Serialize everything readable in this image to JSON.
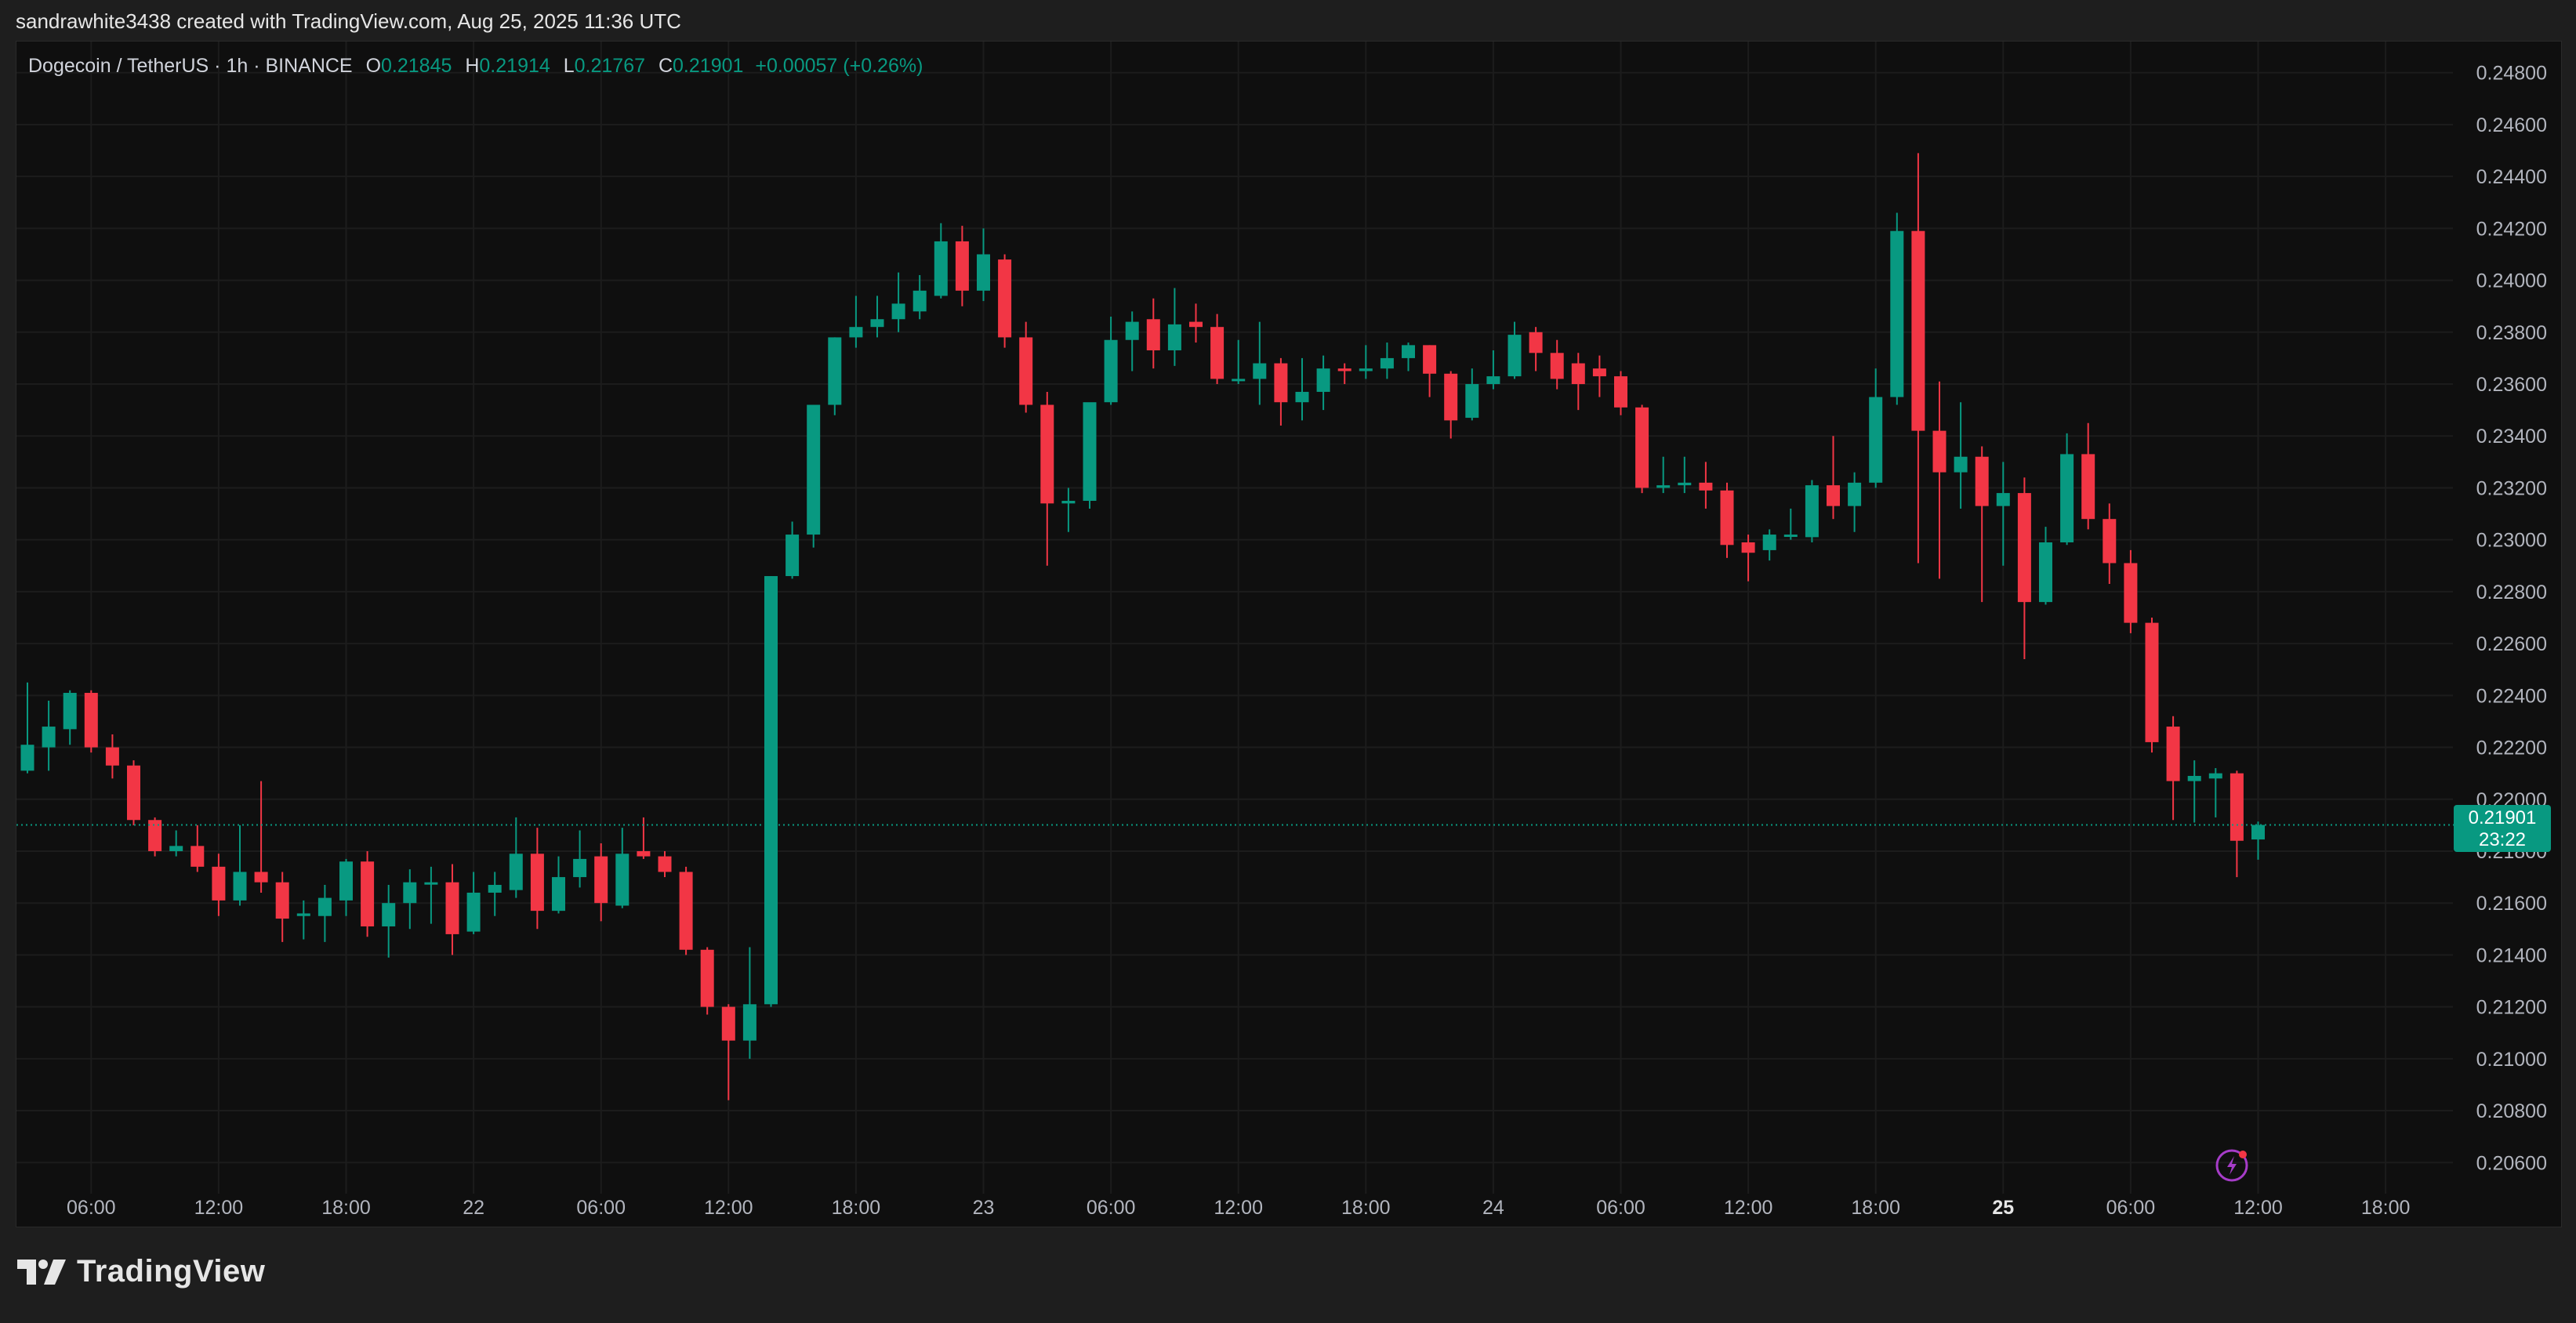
{
  "header": {
    "text": "sandrawhite3438 created with TradingView.com, Aug 25, 2025 11:36 UTC"
  },
  "legend": {
    "symbol": "Dogecoin / TetherUS · 1h · BINANCE",
    "o_label": "O",
    "o": "0.21845",
    "h_label": "H",
    "h": "0.21914",
    "l_label": "L",
    "l": "0.21767",
    "c_label": "C",
    "c": "0.21901",
    "change": "+0.00057 (+0.26%)"
  },
  "last_price": {
    "price": "0.21901",
    "countdown": "23:22"
  },
  "brand": {
    "name": "TradingView"
  },
  "colors": {
    "up": "#089981",
    "down": "#f23645",
    "background": "#0f0f0f",
    "grid": "#1c1c1c"
  },
  "chart_data": {
    "type": "candlestick",
    "title": "",
    "ylim": [
      0.2048,
      0.2492
    ],
    "y_ticks": [
      "0.20600",
      "0.20800",
      "0.21000",
      "0.21200",
      "0.21400",
      "0.21600",
      "0.21800",
      "0.22000",
      "0.22200",
      "0.22400",
      "0.22600",
      "0.22800",
      "0.23000",
      "0.23200",
      "0.23400",
      "0.23600",
      "0.23800",
      "0.24000",
      "0.24200",
      "0.24400",
      "0.24600",
      "0.24800"
    ],
    "x_ticks": [
      {
        "label": "06:00",
        "index": 3,
        "bold": false
      },
      {
        "label": "12:00",
        "index": 9,
        "bold": false
      },
      {
        "label": "18:00",
        "index": 15,
        "bold": false
      },
      {
        "label": "22",
        "index": 21,
        "bold": false
      },
      {
        "label": "06:00",
        "index": 27,
        "bold": false
      },
      {
        "label": "12:00",
        "index": 33,
        "bold": false
      },
      {
        "label": "18:00",
        "index": 39,
        "bold": false
      },
      {
        "label": "23",
        "index": 45,
        "bold": false
      },
      {
        "label": "06:00",
        "index": 51,
        "bold": false
      },
      {
        "label": "12:00",
        "index": 57,
        "bold": false
      },
      {
        "label": "18:00",
        "index": 63,
        "bold": false
      },
      {
        "label": "24",
        "index": 69,
        "bold": false
      },
      {
        "label": "06:00",
        "index": 75,
        "bold": false
      },
      {
        "label": "12:00",
        "index": 81,
        "bold": false
      },
      {
        "label": "18:00",
        "index": 87,
        "bold": false
      },
      {
        "label": "25",
        "index": 93,
        "bold": true
      },
      {
        "label": "06:00",
        "index": 99,
        "bold": false
      },
      {
        "label": "12:00",
        "index": 105,
        "bold": false
      },
      {
        "label": "18:00",
        "index": 111,
        "bold": false
      }
    ],
    "current_price": 0.21901,
    "candles": [
      {
        "o": 0.2211,
        "h": 0.2245,
        "l": 0.221,
        "c": 0.2221
      },
      {
        "o": 0.222,
        "h": 0.2238,
        "l": 0.2211,
        "c": 0.2228
      },
      {
        "o": 0.2227,
        "h": 0.2242,
        "l": 0.2221,
        "c": 0.2241
      },
      {
        "o": 0.2241,
        "h": 0.2242,
        "l": 0.2218,
        "c": 0.222
      },
      {
        "o": 0.222,
        "h": 0.2225,
        "l": 0.2208,
        "c": 0.2213
      },
      {
        "o": 0.2213,
        "h": 0.2215,
        "l": 0.219,
        "c": 0.2192
      },
      {
        "o": 0.2192,
        "h": 0.2193,
        "l": 0.2178,
        "c": 0.218
      },
      {
        "o": 0.218,
        "h": 0.2188,
        "l": 0.2178,
        "c": 0.2182
      },
      {
        "o": 0.2182,
        "h": 0.219,
        "l": 0.2172,
        "c": 0.2174
      },
      {
        "o": 0.2174,
        "h": 0.2179,
        "l": 0.2155,
        "c": 0.2161
      },
      {
        "o": 0.2161,
        "h": 0.219,
        "l": 0.2159,
        "c": 0.2172
      },
      {
        "o": 0.2172,
        "h": 0.2207,
        "l": 0.2164,
        "c": 0.2168
      },
      {
        "o": 0.2168,
        "h": 0.2172,
        "l": 0.2145,
        "c": 0.2154
      },
      {
        "o": 0.2155,
        "h": 0.2161,
        "l": 0.2146,
        "c": 0.2156
      },
      {
        "o": 0.2155,
        "h": 0.2167,
        "l": 0.2145,
        "c": 0.2162
      },
      {
        "o": 0.2161,
        "h": 0.2177,
        "l": 0.2155,
        "c": 0.2176
      },
      {
        "o": 0.2176,
        "h": 0.218,
        "l": 0.2147,
        "c": 0.2151
      },
      {
        "o": 0.2151,
        "h": 0.2167,
        "l": 0.2139,
        "c": 0.216
      },
      {
        "o": 0.216,
        "h": 0.2173,
        "l": 0.215,
        "c": 0.2168
      },
      {
        "o": 0.2168,
        "h": 0.2174,
        "l": 0.2152,
        "c": 0.2168
      },
      {
        "o": 0.2168,
        "h": 0.2175,
        "l": 0.214,
        "c": 0.2148
      },
      {
        "o": 0.2149,
        "h": 0.2172,
        "l": 0.2148,
        "c": 0.2164
      },
      {
        "o": 0.2164,
        "h": 0.2172,
        "l": 0.2155,
        "c": 0.2167
      },
      {
        "o": 0.2165,
        "h": 0.2193,
        "l": 0.2162,
        "c": 0.2179
      },
      {
        "o": 0.2179,
        "h": 0.2189,
        "l": 0.215,
        "c": 0.2157
      },
      {
        "o": 0.2157,
        "h": 0.2178,
        "l": 0.2156,
        "c": 0.217
      },
      {
        "o": 0.217,
        "h": 0.2188,
        "l": 0.2166,
        "c": 0.2177
      },
      {
        "o": 0.2178,
        "h": 0.2183,
        "l": 0.2153,
        "c": 0.216
      },
      {
        "o": 0.2159,
        "h": 0.2189,
        "l": 0.2158,
        "c": 0.2179
      },
      {
        "o": 0.218,
        "h": 0.2193,
        "l": 0.2177,
        "c": 0.2178
      },
      {
        "o": 0.2178,
        "h": 0.218,
        "l": 0.217,
        "c": 0.2172
      },
      {
        "o": 0.2172,
        "h": 0.2174,
        "l": 0.214,
        "c": 0.2142
      },
      {
        "o": 0.2142,
        "h": 0.2143,
        "l": 0.2117,
        "c": 0.212
      },
      {
        "o": 0.212,
        "h": 0.2121,
        "l": 0.2084,
        "c": 0.2107
      },
      {
        "o": 0.2107,
        "h": 0.2143,
        "l": 0.21,
        "c": 0.2121
      },
      {
        "o": 0.2121,
        "h": 0.2286,
        "l": 0.212,
        "c": 0.2286
      },
      {
        "o": 0.2286,
        "h": 0.2307,
        "l": 0.2285,
        "c": 0.2302
      },
      {
        "o": 0.2302,
        "h": 0.2352,
        "l": 0.2297,
        "c": 0.2352
      },
      {
        "o": 0.2352,
        "h": 0.2378,
        "l": 0.2348,
        "c": 0.2378
      },
      {
        "o": 0.2378,
        "h": 0.2394,
        "l": 0.2374,
        "c": 0.2382
      },
      {
        "o": 0.2382,
        "h": 0.2394,
        "l": 0.2378,
        "c": 0.2385
      },
      {
        "o": 0.2385,
        "h": 0.2403,
        "l": 0.238,
        "c": 0.2391
      },
      {
        "o": 0.2388,
        "h": 0.2402,
        "l": 0.2385,
        "c": 0.2396
      },
      {
        "o": 0.2394,
        "h": 0.2422,
        "l": 0.2393,
        "c": 0.2415
      },
      {
        "o": 0.2415,
        "h": 0.2421,
        "l": 0.239,
        "c": 0.2396
      },
      {
        "o": 0.2396,
        "h": 0.242,
        "l": 0.2392,
        "c": 0.241
      },
      {
        "o": 0.2408,
        "h": 0.241,
        "l": 0.2374,
        "c": 0.2378
      },
      {
        "o": 0.2378,
        "h": 0.2384,
        "l": 0.2349,
        "c": 0.2352
      },
      {
        "o": 0.2352,
        "h": 0.2357,
        "l": 0.229,
        "c": 0.2314
      },
      {
        "o": 0.2314,
        "h": 0.232,
        "l": 0.2303,
        "c": 0.2315
      },
      {
        "o": 0.2315,
        "h": 0.2352,
        "l": 0.2312,
        "c": 0.2353
      },
      {
        "o": 0.2353,
        "h": 0.2386,
        "l": 0.2352,
        "c": 0.2377
      },
      {
        "o": 0.2377,
        "h": 0.2388,
        "l": 0.2365,
        "c": 0.2384
      },
      {
        "o": 0.2385,
        "h": 0.2393,
        "l": 0.2366,
        "c": 0.2373
      },
      {
        "o": 0.2373,
        "h": 0.2397,
        "l": 0.2367,
        "c": 0.2383
      },
      {
        "o": 0.2384,
        "h": 0.2391,
        "l": 0.2376,
        "c": 0.2382
      },
      {
        "o": 0.2382,
        "h": 0.2387,
        "l": 0.236,
        "c": 0.2362
      },
      {
        "o": 0.2362,
        "h": 0.2377,
        "l": 0.236,
        "c": 0.2362
      },
      {
        "o": 0.2362,
        "h": 0.2384,
        "l": 0.2352,
        "c": 0.2368
      },
      {
        "o": 0.2368,
        "h": 0.237,
        "l": 0.2344,
        "c": 0.2353
      },
      {
        "o": 0.2353,
        "h": 0.237,
        "l": 0.2346,
        "c": 0.2357
      },
      {
        "o": 0.2357,
        "h": 0.2371,
        "l": 0.235,
        "c": 0.2366
      },
      {
        "o": 0.2366,
        "h": 0.2368,
        "l": 0.236,
        "c": 0.2365
      },
      {
        "o": 0.2365,
        "h": 0.2375,
        "l": 0.2362,
        "c": 0.2366
      },
      {
        "o": 0.2366,
        "h": 0.2376,
        "l": 0.2362,
        "c": 0.237
      },
      {
        "o": 0.237,
        "h": 0.2376,
        "l": 0.2365,
        "c": 0.2375
      },
      {
        "o": 0.2375,
        "h": 0.2375,
        "l": 0.2355,
        "c": 0.2364
      },
      {
        "o": 0.2364,
        "h": 0.2365,
        "l": 0.2339,
        "c": 0.2346
      },
      {
        "o": 0.2347,
        "h": 0.2366,
        "l": 0.2346,
        "c": 0.236
      },
      {
        "o": 0.236,
        "h": 0.2373,
        "l": 0.2358,
        "c": 0.2363
      },
      {
        "o": 0.2363,
        "h": 0.2384,
        "l": 0.2362,
        "c": 0.2379
      },
      {
        "o": 0.238,
        "h": 0.2382,
        "l": 0.2365,
        "c": 0.2372
      },
      {
        "o": 0.2372,
        "h": 0.2377,
        "l": 0.2358,
        "c": 0.2362
      },
      {
        "o": 0.2368,
        "h": 0.2372,
        "l": 0.235,
        "c": 0.236
      },
      {
        "o": 0.2366,
        "h": 0.2371,
        "l": 0.2355,
        "c": 0.2363
      },
      {
        "o": 0.2363,
        "h": 0.2365,
        "l": 0.2348,
        "c": 0.2351
      },
      {
        "o": 0.2351,
        "h": 0.2352,
        "l": 0.2318,
        "c": 0.232
      },
      {
        "o": 0.232,
        "h": 0.2332,
        "l": 0.2318,
        "c": 0.2321
      },
      {
        "o": 0.2321,
        "h": 0.2332,
        "l": 0.2318,
        "c": 0.2322
      },
      {
        "o": 0.2322,
        "h": 0.233,
        "l": 0.2312,
        "c": 0.2319
      },
      {
        "o": 0.2319,
        "h": 0.2322,
        "l": 0.2293,
        "c": 0.2298
      },
      {
        "o": 0.2299,
        "h": 0.2302,
        "l": 0.2284,
        "c": 0.2295
      },
      {
        "o": 0.2296,
        "h": 0.2304,
        "l": 0.2292,
        "c": 0.2302
      },
      {
        "o": 0.2302,
        "h": 0.2312,
        "l": 0.23,
        "c": 0.2302
      },
      {
        "o": 0.2301,
        "h": 0.2323,
        "l": 0.2299,
        "c": 0.2321
      },
      {
        "o": 0.2321,
        "h": 0.234,
        "l": 0.2308,
        "c": 0.2313
      },
      {
        "o": 0.2313,
        "h": 0.2326,
        "l": 0.2303,
        "c": 0.2322
      },
      {
        "o": 0.2322,
        "h": 0.2366,
        "l": 0.232,
        "c": 0.2355
      },
      {
        "o": 0.2355,
        "h": 0.2426,
        "l": 0.2352,
        "c": 0.2419
      },
      {
        "o": 0.2419,
        "h": 0.2449,
        "l": 0.2291,
        "c": 0.2342
      },
      {
        "o": 0.2342,
        "h": 0.2361,
        "l": 0.2285,
        "c": 0.2326
      },
      {
        "o": 0.2326,
        "h": 0.2353,
        "l": 0.2312,
        "c": 0.2332
      },
      {
        "o": 0.2332,
        "h": 0.2336,
        "l": 0.2276,
        "c": 0.2313
      },
      {
        "o": 0.2313,
        "h": 0.233,
        "l": 0.229,
        "c": 0.2318
      },
      {
        "o": 0.2318,
        "h": 0.2324,
        "l": 0.2254,
        "c": 0.2276
      },
      {
        "o": 0.2276,
        "h": 0.2305,
        "l": 0.2275,
        "c": 0.2299
      },
      {
        "o": 0.2299,
        "h": 0.2341,
        "l": 0.2298,
        "c": 0.2333
      },
      {
        "o": 0.2333,
        "h": 0.2345,
        "l": 0.2304,
        "c": 0.2308
      },
      {
        "o": 0.2308,
        "h": 0.2314,
        "l": 0.2283,
        "c": 0.2291
      },
      {
        "o": 0.2291,
        "h": 0.2296,
        "l": 0.2264,
        "c": 0.2268
      },
      {
        "o": 0.2268,
        "h": 0.227,
        "l": 0.2218,
        "c": 0.2222
      },
      {
        "o": 0.2228,
        "h": 0.2232,
        "l": 0.2192,
        "c": 0.2207
      },
      {
        "o": 0.2207,
        "h": 0.2215,
        "l": 0.2191,
        "c": 0.2209
      },
      {
        "o": 0.2208,
        "h": 0.2212,
        "l": 0.2193,
        "c": 0.221
      },
      {
        "o": 0.221,
        "h": 0.2211,
        "l": 0.217,
        "c": 0.2184
      },
      {
        "o": 0.21845,
        "h": 0.21914,
        "l": 0.21767,
        "c": 0.21901
      }
    ]
  }
}
